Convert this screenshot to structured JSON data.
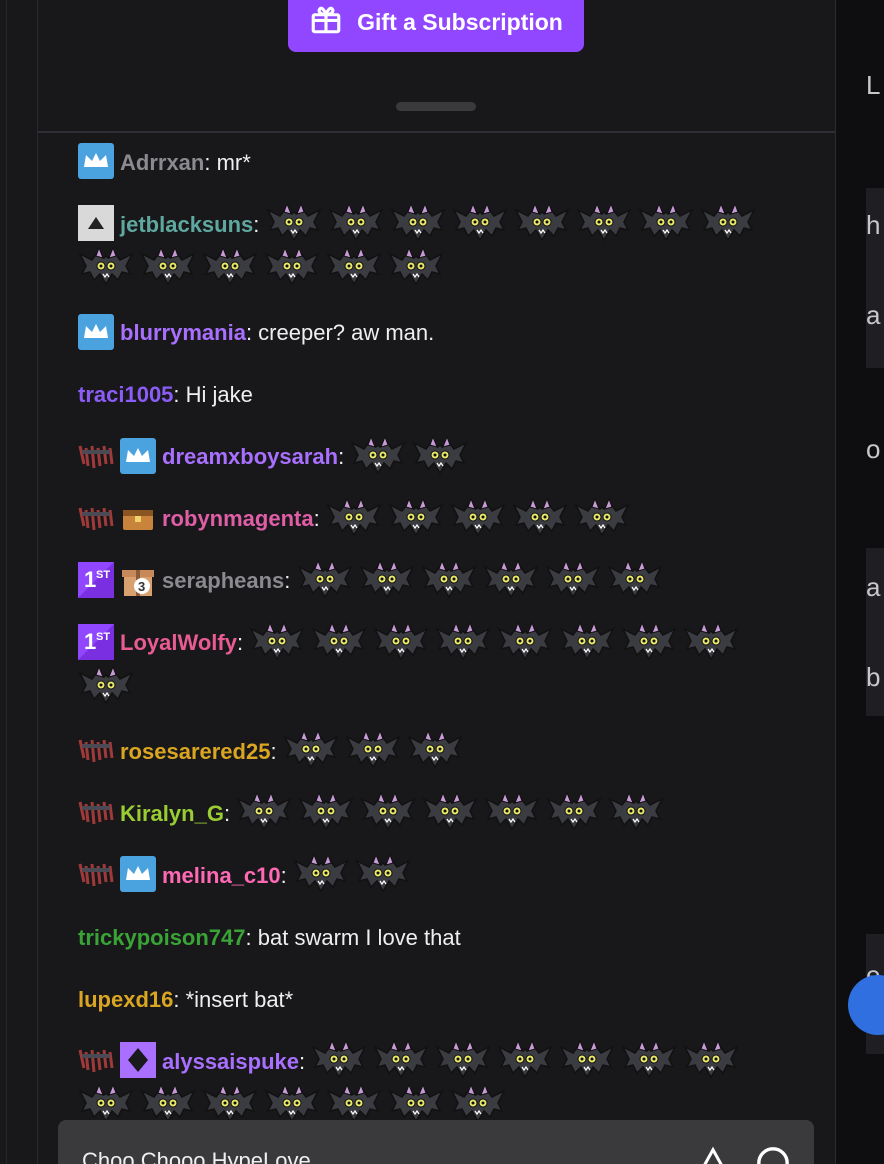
{
  "gift_button": {
    "label": "Gift a Subscription",
    "icon": "gift-icon"
  },
  "messages": [
    {
      "badges": [
        "prime-crown"
      ],
      "user": "Adrrxan",
      "color": "#8a8a8f",
      "text": "mr*",
      "emotes": 0
    },
    {
      "badges": [
        "triangle-box"
      ],
      "user": "jetblacksuns",
      "color": "#5fa8a0",
      "text": "",
      "emotes": 14
    },
    {
      "badges": [
        "prime-crown"
      ],
      "user": "blurrymania",
      "color": "#a970ff",
      "text": "creeper? aw man.",
      "emotes": 0
    },
    {
      "badges": [],
      "user": "traci1005",
      "color": "#8b5cf6",
      "text": "Hi jake",
      "emotes": 0
    },
    {
      "badges": [
        "bat-badge",
        "prime-crown"
      ],
      "user": "dreamxboysarah",
      "color": "#a970ff",
      "text": "",
      "emotes": 2
    },
    {
      "badges": [
        "bat-badge",
        "treasure-chest"
      ],
      "user": "robynmagenta",
      "color": "#e05ea6",
      "text": "",
      "emotes": 5
    },
    {
      "badges": [
        "first-badge",
        "gift-3-badge"
      ],
      "user": "serapheans",
      "color": "#8a8a8f",
      "text": "",
      "emotes": 6
    },
    {
      "badges": [
        "first-badge"
      ],
      "user": "LoyalWolfy",
      "color": "#e95b93",
      "text": "",
      "emotes": 9
    },
    {
      "badges": [
        "bat-badge"
      ],
      "user": "rosesarered25",
      "color": "#daa520",
      "text": "",
      "emotes": 3
    },
    {
      "badges": [
        "bat-badge"
      ],
      "user": "Kiralyn_G",
      "color": "#9acd32",
      "text": "",
      "emotes": 7
    },
    {
      "badges": [
        "bat-badge",
        "prime-crown"
      ],
      "user": "melina_c10",
      "color": "#ff69b4",
      "text": "",
      "emotes": 2
    },
    {
      "badges": [],
      "user": "trickypoison747",
      "color": "#3aa335",
      "text": "bat swarm I love that",
      "emotes": 0
    },
    {
      "badges": [],
      "user": "lupexd16",
      "color": "#daa520",
      "text": "*insert bat*",
      "emotes": 0
    },
    {
      "badges": [
        "bat-badge",
        "diamond-badge"
      ],
      "user": "alyssaispuke",
      "color": "#a970ff",
      "text": "",
      "emotes": 14
    }
  ],
  "separator": ": ",
  "chat_input": {
    "placeholder": "Choo Chooo HypeLove"
  },
  "right_strip_letters": [
    "L",
    "h",
    "a",
    "o",
    "a",
    "b",
    "e"
  ],
  "colors": {
    "accent": "#9147ff",
    "panel": "#18181b",
    "background": "#0e0e10"
  }
}
